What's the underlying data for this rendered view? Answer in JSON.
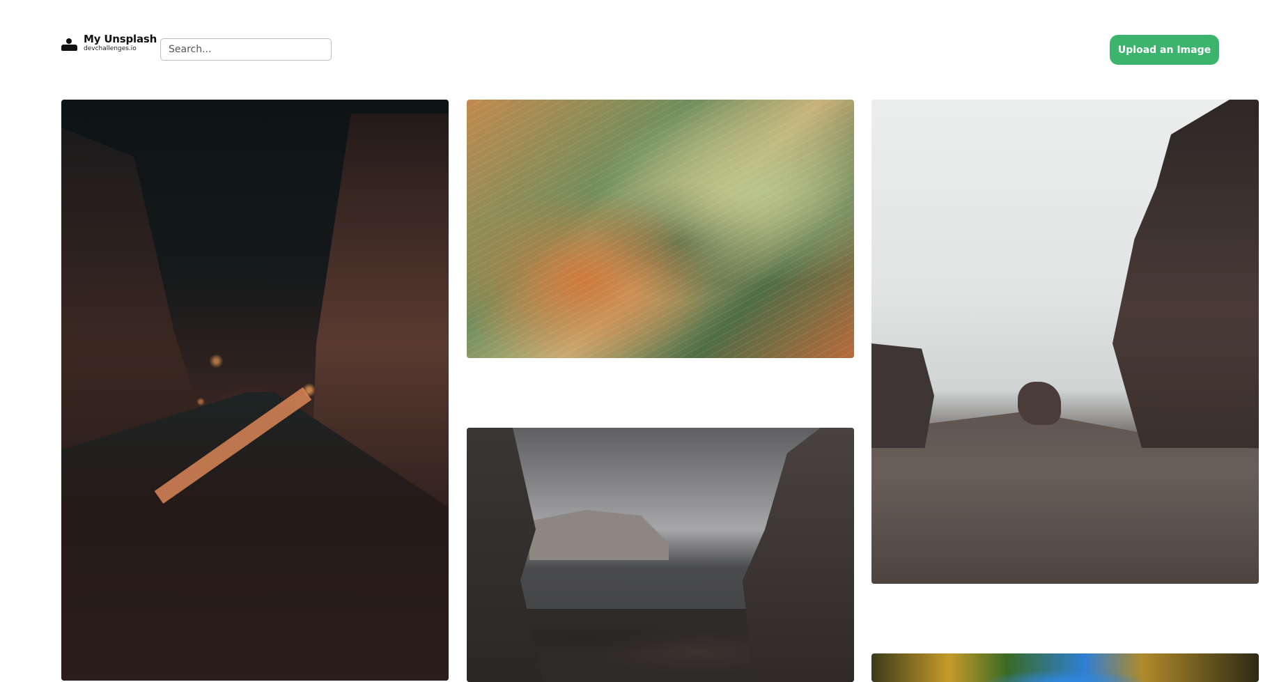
{
  "header": {
    "brand_title": "My Unsplash",
    "brand_subtitle": "devchallenges.io",
    "brand_icon": "user-icon",
    "search_placeholder": "Search...",
    "search_value": "",
    "upload_label": "Upload an Image",
    "upload_color": "#3db46d"
  },
  "gallery": {
    "images": [
      {
        "subject": "night-street"
      },
      {
        "subject": "wheat-field"
      },
      {
        "subject": "foggy-coastal-rocks"
      },
      {
        "subject": "sea-cliffs"
      },
      {
        "subject": "autumn-trees"
      }
    ]
  }
}
